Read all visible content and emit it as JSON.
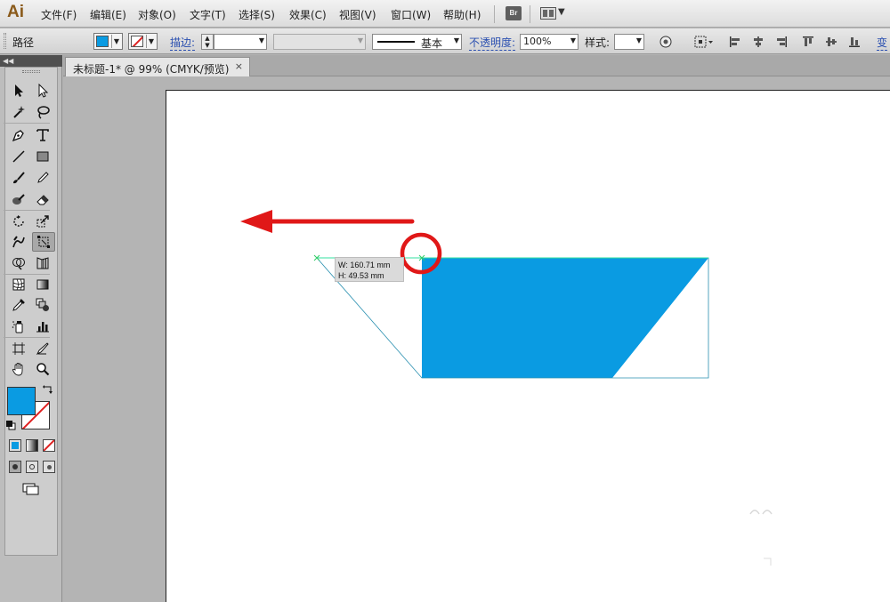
{
  "app": {
    "logo": "Ai"
  },
  "menu": {
    "items": [
      "文件(F)",
      "编辑(E)",
      "对象(O)",
      "文字(T)",
      "选择(S)",
      "效果(C)",
      "视图(V)",
      "窗口(W)",
      "帮助(H)"
    ],
    "bridge_label": "Br"
  },
  "control": {
    "selection_label": "路径",
    "stroke_label": "描边:",
    "stroke_style": "基本",
    "opacity_label": "不透明度:",
    "opacity_value": "100%",
    "style_label": "样式:",
    "transform_label": "变"
  },
  "document": {
    "tab_title": "未标题-1* @ 99% (CMYK/预览)",
    "tab_close": "×"
  },
  "tooltip": {
    "width": "W: 160.71 mm",
    "height": "H: 49.53 mm"
  },
  "colors": {
    "fill": "#0a9be2",
    "annotation": "#e01818",
    "path": "#00a0c8"
  },
  "icons": {
    "tools": [
      "selection-tool-icon",
      "direct-selection-tool-icon",
      "magic-wand-tool-icon",
      "lasso-tool-icon",
      "pen-tool-icon",
      "type-tool-icon",
      "line-tool-icon",
      "rectangle-tool-icon",
      "paintbrush-tool-icon",
      "pencil-tool-icon",
      "blob-brush-tool-icon",
      "eraser-tool-icon",
      "rotate-tool-icon",
      "scale-tool-icon",
      "warp-tool-icon",
      "free-transform-tool-icon",
      "shape-builder-tool-icon",
      "perspective-grid-tool-icon",
      "mesh-tool-icon",
      "gradient-tool-icon",
      "eyedropper-tool-icon",
      "blend-tool-icon",
      "symbol-sprayer-tool-icon",
      "column-graph-tool-icon",
      "artboard-tool-icon",
      "slice-tool-icon",
      "hand-tool-icon",
      "zoom-tool-icon"
    ]
  }
}
